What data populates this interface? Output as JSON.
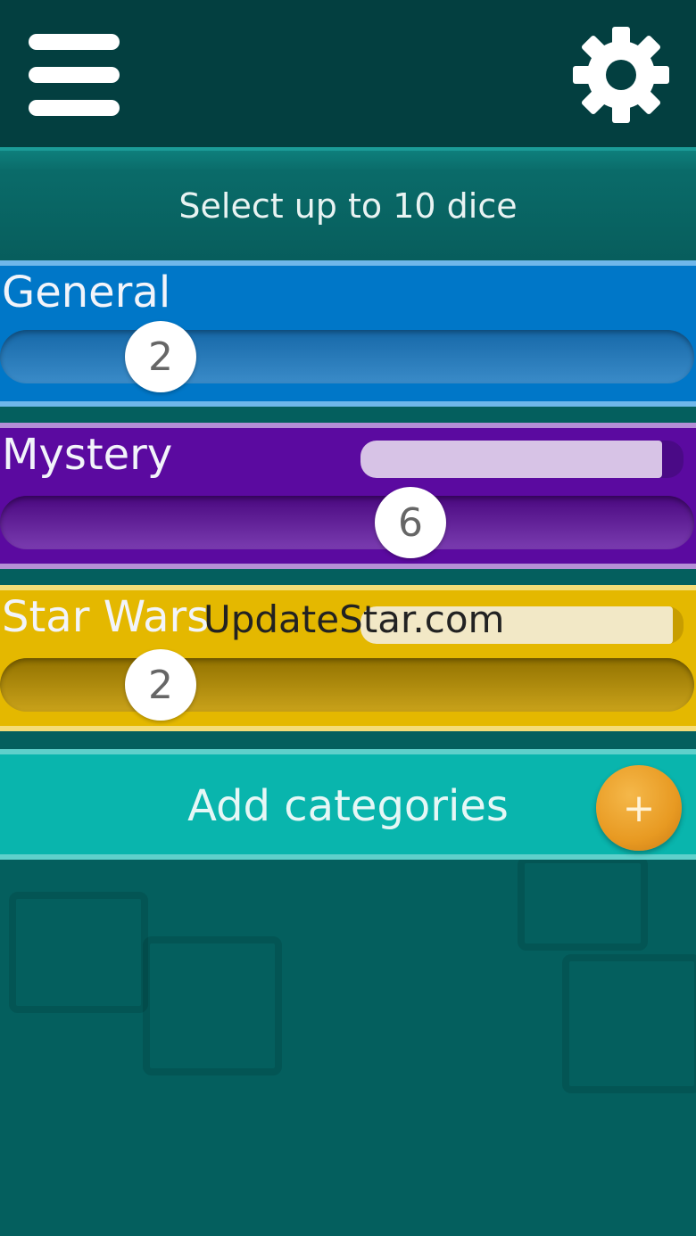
{
  "colors": {
    "background": "#045f5e",
    "topbar": "#033f40",
    "general": "#0077c8",
    "mystery": "#5b0aa0",
    "starwars": "#e4b800",
    "add_bar": "#09b5ad",
    "add_button": "#e89a22"
  },
  "topbar": {
    "menu_icon": "hamburger-menu-icon",
    "settings_icon": "gear-icon"
  },
  "header": {
    "subtitle": "Select up to 10 dice"
  },
  "categories": [
    {
      "name": "General",
      "dice_count": "2",
      "slider_fraction": 0.2
    },
    {
      "name": "Mystery",
      "dice_count": "6",
      "slider_fraction": 0.6
    },
    {
      "name": "Star Wars",
      "dice_count": "2",
      "slider_fraction": 0.2
    }
  ],
  "watermark": "UpdateStar.com",
  "add": {
    "label": "Add categories",
    "button_symbol": "+"
  }
}
